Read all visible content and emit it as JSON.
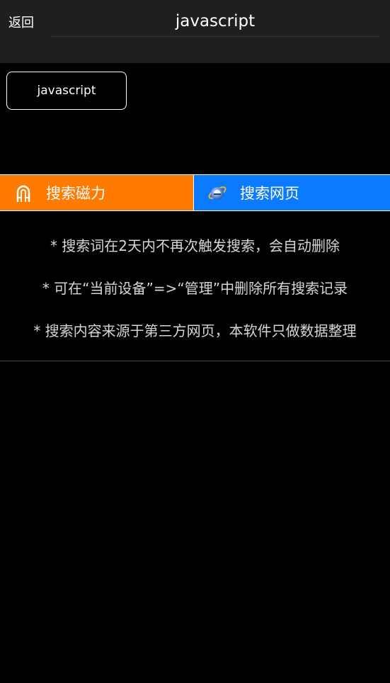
{
  "header": {
    "back_label": "返回",
    "search_value": "javascript"
  },
  "history": {
    "chips": [
      "javascript"
    ]
  },
  "tabs": [
    {
      "label": "搜索磁力",
      "icon": "magnet-icon",
      "color": "#ff7a00"
    },
    {
      "label": "搜索网页",
      "icon": "ie-browser-icon",
      "color": "#0a7bff"
    }
  ],
  "notes": [
    "* 搜索词在2天内不再次触发搜索，会自动删除",
    "* 可在“当前设备”=>“管理”中删除所有搜索记录",
    "* 搜索内容来源于第三方网页，本软件只做数据整理"
  ],
  "colors": {
    "header_bg": "#1f1f1f",
    "page_bg": "#000000",
    "magnet_tab": "#ff7a00",
    "web_tab": "#0a7bff"
  }
}
